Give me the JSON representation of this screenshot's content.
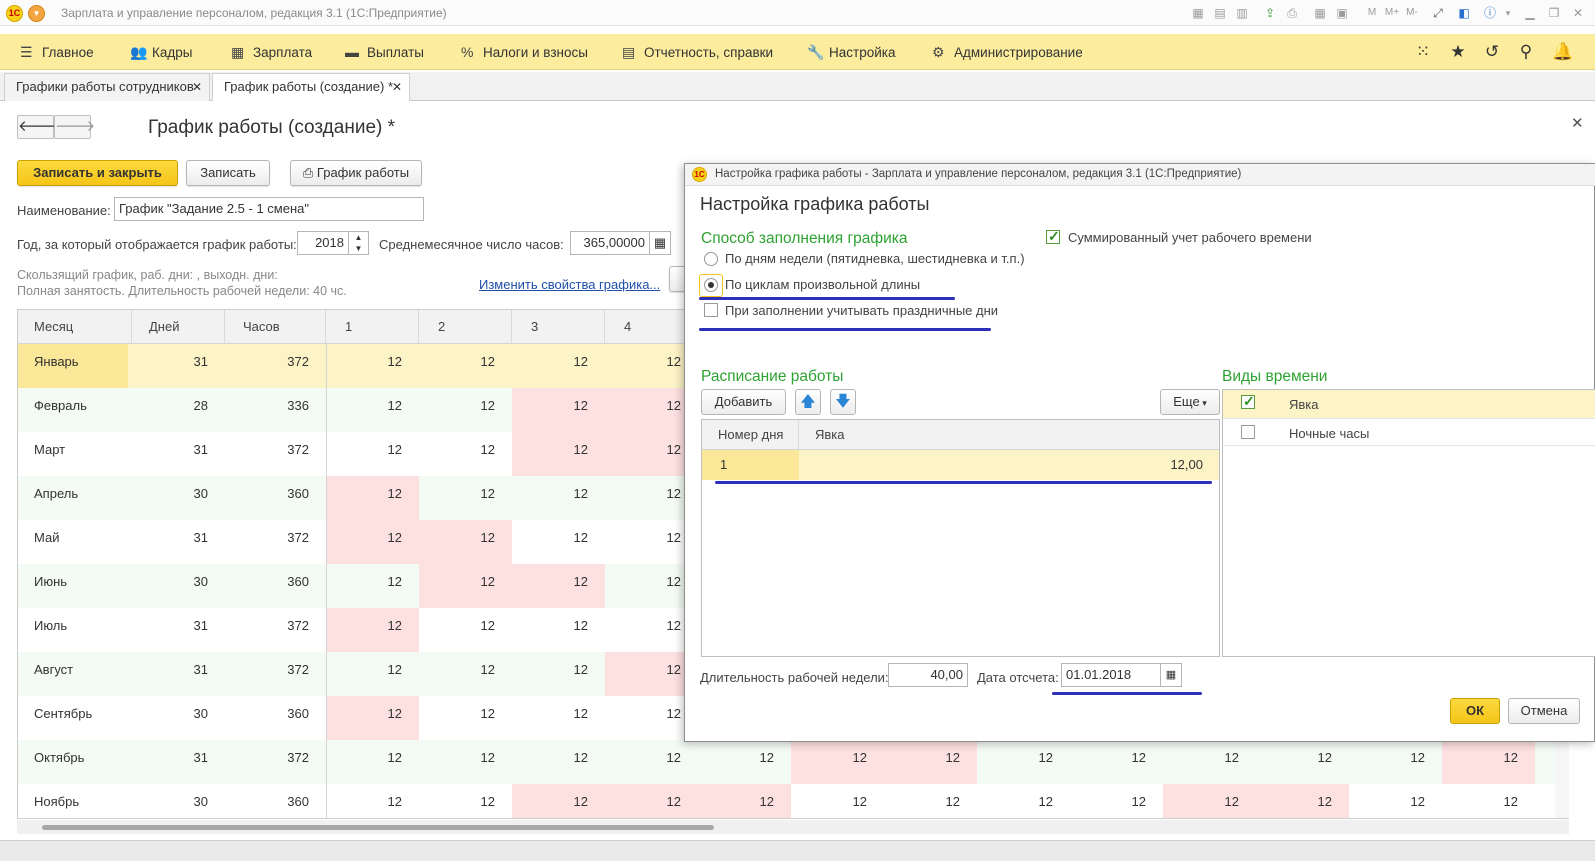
{
  "window": {
    "title": "Зарплата и управление персоналом, редакция 3.1 (1С:Предприятие)",
    "logo": "1С"
  },
  "mainmenu": {
    "items": [
      "Главное",
      "Кадры",
      "Зарплата",
      "Выплаты",
      "Налоги и взносы",
      "Отчетность, справки",
      "Настройка",
      "Администрирование"
    ],
    "icons": [
      "menu-icon",
      "people-icon",
      "calculator-icon",
      "wallet-icon",
      "percent-icon",
      "report-icon",
      "wrench-icon",
      "gear-icon"
    ],
    "right_icons": [
      "apps-grid-icon",
      "star-icon",
      "history-icon",
      "search-icon",
      "bell-icon"
    ]
  },
  "tabs": [
    {
      "label": "Графики работы сотрудников",
      "active": false
    },
    {
      "label": "График работы (создание) *",
      "active": true
    }
  ],
  "form": {
    "title": "График работы (создание) *",
    "save_close": "Записать и закрыть",
    "save": "Записать",
    "schedule_btn": "График работы",
    "name_label": "Наименование:",
    "name_value": "График \"Задание 2.5 - 1 смена\"",
    "year_label": "Год, за который отображается график работы:",
    "year_value": "2018",
    "avg_label": "Среднемесячное число часов:",
    "avg_value": "365,00000",
    "note1": "Скользящий график, раб. дни: , выходн. дни:",
    "note2": "Полная занятость. Длительность рабочей недели: 40 чс.",
    "change_link": "Изменить свойства графика..."
  },
  "grid": {
    "columns": [
      "Месяц",
      "Дней",
      "Часов",
      "1",
      "2",
      "3",
      "4"
    ],
    "rows": [
      {
        "month": "Январь",
        "days": "31",
        "hours": "372",
        "v": [
          "12",
          "12",
          "12",
          "12",
          "",
          "",
          "",
          "",
          "",
          "",
          "",
          "",
          ""
        ],
        "red": []
      },
      {
        "month": "Февраль",
        "days": "28",
        "hours": "336",
        "v": [
          "12",
          "12",
          "12",
          "12",
          "",
          "",
          "",
          "",
          "",
          "",
          "",
          "",
          ""
        ],
        "red": [
          2,
          3
        ]
      },
      {
        "month": "Март",
        "days": "31",
        "hours": "372",
        "v": [
          "12",
          "12",
          "12",
          "12",
          "",
          "",
          "",
          "",
          "",
          "",
          "",
          "",
          ""
        ],
        "red": [
          2,
          3
        ]
      },
      {
        "month": "Апрель",
        "days": "30",
        "hours": "360",
        "v": [
          "12",
          "12",
          "12",
          "12",
          "",
          "",
          "",
          "",
          "",
          "",
          "",
          "",
          ""
        ],
        "red": [
          0
        ]
      },
      {
        "month": "Май",
        "days": "31",
        "hours": "372",
        "v": [
          "12",
          "12",
          "12",
          "12",
          "",
          "",
          "",
          "",
          "",
          "",
          "",
          "",
          ""
        ],
        "red": [
          0,
          1
        ]
      },
      {
        "month": "Июнь",
        "days": "30",
        "hours": "360",
        "v": [
          "12",
          "12",
          "12",
          "12",
          "",
          "",
          "",
          "",
          "",
          "",
          "",
          "",
          ""
        ],
        "red": [
          1,
          2
        ]
      },
      {
        "month": "Июль",
        "days": "31",
        "hours": "372",
        "v": [
          "12",
          "12",
          "12",
          "12",
          "",
          "",
          "",
          "",
          "",
          "",
          "",
          "",
          ""
        ],
        "red": [
          0
        ]
      },
      {
        "month": "Август",
        "days": "31",
        "hours": "372",
        "v": [
          "12",
          "12",
          "12",
          "12",
          "",
          "",
          "",
          "",
          "",
          "",
          "",
          "",
          ""
        ],
        "red": [
          3
        ]
      },
      {
        "month": "Сентябрь",
        "days": "30",
        "hours": "360",
        "v": [
          "12",
          "12",
          "12",
          "12",
          "",
          "",
          "",
          "",
          "",
          "",
          "",
          "",
          ""
        ],
        "red": [
          0
        ]
      },
      {
        "month": "Октябрь",
        "days": "31",
        "hours": "372",
        "v": [
          "12",
          "12",
          "12",
          "12",
          "12",
          "12",
          "12",
          "12",
          "12",
          "12",
          "12",
          "12",
          "12"
        ],
        "red": [
          5,
          6,
          12
        ]
      },
      {
        "month": "Ноябрь",
        "days": "30",
        "hours": "360",
        "v": [
          "12",
          "12",
          "12",
          "12",
          "12",
          "12",
          "12",
          "12",
          "12",
          "12",
          "12",
          "12",
          "12"
        ],
        "red": [
          2,
          3,
          4,
          9,
          10
        ]
      }
    ]
  },
  "dialog": {
    "window_title": "Настройка графика работы - Зарплата и управление персоналом, редакция 3.1  (1С:Предприятие)",
    "heading": "Настройка графика работы",
    "fill_method_title": "Способ заполнения графика",
    "radio_weekdays": "По дням недели (пятидневка, шестидневка и т.п.)",
    "radio_cycles": "По циклам произвольной длины",
    "check_holidays": "При заполнении учитывать праздничные дни",
    "check_summed": "Суммированный учет рабочего времени",
    "schedule_title": "Расписание работы",
    "add_btn": "Добавить",
    "more_btn": "Еще",
    "schedule_cols": [
      "Номер дня",
      "Явка"
    ],
    "schedule_rows": [
      {
        "day": "1",
        "value": "12,00"
      }
    ],
    "time_types_title": "Виды времени",
    "time_types": [
      {
        "label": "Явка",
        "checked": true
      },
      {
        "label": "Ночные часы",
        "checked": false
      }
    ],
    "week_len_label": "Длительность рабочей недели:",
    "week_len_value": "40,00",
    "ref_date_label": "Дата отсчета:",
    "ref_date_value": "01.01.2018",
    "ok": "ОК",
    "cancel": "Отмена"
  },
  "colors": {
    "accent_yellow": "#f5c518",
    "menu_bg": "#fbec9e",
    "weekend_pink": "#fde0e0",
    "section_green": "#2ea232",
    "annotation_blue": "#2d2fb8"
  }
}
